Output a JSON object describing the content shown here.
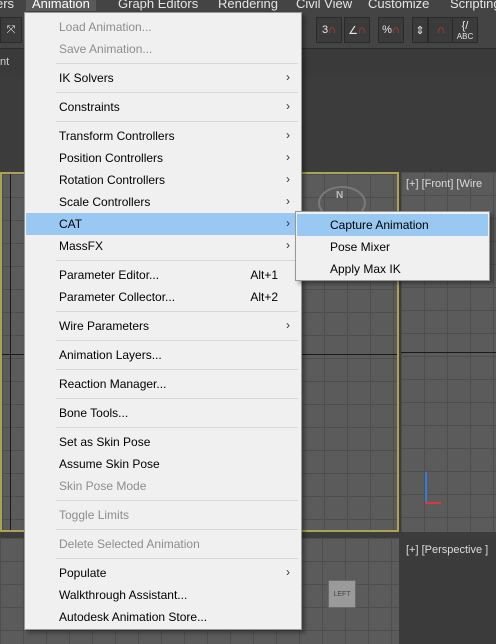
{
  "menubar": {
    "items": [
      "ers",
      "Animation",
      "Graph Editors",
      "Rendering",
      "Civil View",
      "Customize",
      "Scripting"
    ]
  },
  "toolbar": {
    "buttons": [
      {
        "icon": "snap-3d-icon",
        "text": "3"
      },
      {
        "icon": "angle-snap-icon",
        "text": "∠"
      },
      {
        "icon": "percent-snap-icon",
        "text": "%"
      },
      {
        "icon": "spinner-snap-icon",
        "text": "⇕"
      },
      {
        "icon": "edit-named-selection-icon",
        "text": "{/"
      }
    ],
    "abc_label": "ABC"
  },
  "ribbon": {
    "text": "nt"
  },
  "viewports": {
    "front_label": "[+] [Front] [Wire",
    "perspective_label": "[+] [Perspective ]",
    "compass_letter": "N",
    "viewcube_label": "LEFT"
  },
  "animation_menu": {
    "items": [
      {
        "label": "Load Animation...",
        "disabled": true
      },
      {
        "label": "Save Animation...",
        "disabled": true
      },
      {
        "label": "IK Solvers",
        "submenu": true
      },
      {
        "label": "Constraints",
        "submenu": true
      },
      {
        "label": "Transform Controllers",
        "submenu": true
      },
      {
        "label": "Position Controllers",
        "submenu": true
      },
      {
        "label": "Rotation Controllers",
        "submenu": true
      },
      {
        "label": "Scale Controllers",
        "submenu": true
      },
      {
        "label": "CAT",
        "submenu": true,
        "highlighted": true
      },
      {
        "label": "MassFX",
        "submenu": true
      },
      {
        "label": "Parameter Editor...",
        "shortcut": "Alt+1"
      },
      {
        "label": "Parameter Collector...",
        "shortcut": "Alt+2"
      },
      {
        "label": "Wire Parameters",
        "submenu": true
      },
      {
        "label": "Animation Layers..."
      },
      {
        "label": "Reaction Manager..."
      },
      {
        "label": "Bone Tools..."
      },
      {
        "label": "Set as Skin Pose"
      },
      {
        "label": "Assume Skin Pose"
      },
      {
        "label": "Skin Pose Mode",
        "disabled": true
      },
      {
        "label": "Toggle Limits",
        "disabled": true
      },
      {
        "label": "Delete Selected Animation",
        "disabled": true
      },
      {
        "label": "Populate",
        "submenu": true
      },
      {
        "label": "Walkthrough Assistant..."
      },
      {
        "label": "Autodesk Animation Store..."
      }
    ],
    "submenu_arrow": "›"
  },
  "cat_submenu": {
    "items": [
      {
        "label": "Capture Animation",
        "highlighted": true
      },
      {
        "label": "Pose Mixer"
      },
      {
        "label": "Apply Max IK"
      }
    ]
  },
  "colors": {
    "menu_bg": "#f0f0f0",
    "highlight": "#99c9f3",
    "disabled_text": "#8d8d8d",
    "viewport_border_active": "#a9a352"
  }
}
